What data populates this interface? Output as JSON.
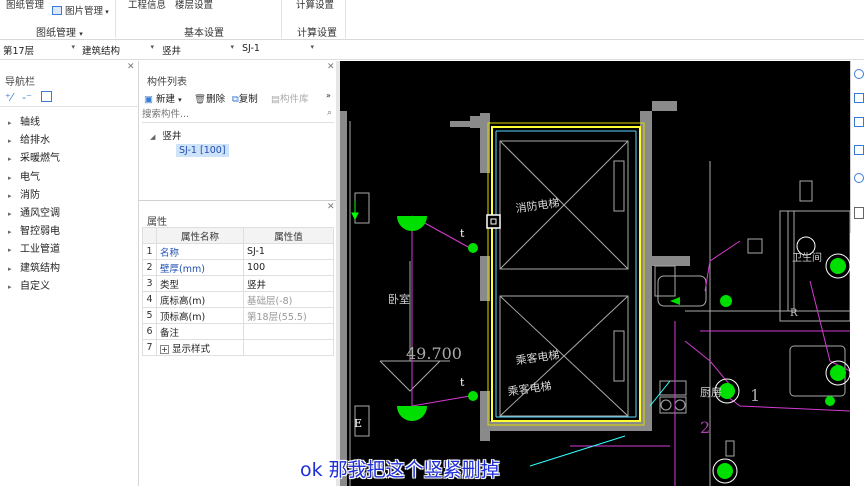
{
  "ribbon": {
    "drawing_mgmt": "图纸管理",
    "image_mgmt": "图片管理",
    "project_info": "工程信息",
    "floor_settings": "楼层设置",
    "calc_settings": "计算设置",
    "group_drawing": "图纸管理",
    "group_basic": "基本设置",
    "group_calc": "计算设置"
  },
  "selectors": {
    "floor": "第17层",
    "category": "建筑结构",
    "type": "竖井",
    "item": "SJ-1"
  },
  "nav": {
    "title": "导航栏",
    "items": [
      "轴线",
      "给排水",
      "采暖燃气",
      "电气",
      "消防",
      "通风空调",
      "智控弱电",
      "工业管道",
      "建筑结构",
      "自定义"
    ]
  },
  "components": {
    "title": "构件列表",
    "new_label": "新建",
    "delete_label": "删除",
    "copy_label": "复制",
    "library_label": "构件库",
    "search_placeholder": "搜索构件...",
    "tree_root": "竖井",
    "tree_child": "SJ-1 [100]"
  },
  "properties": {
    "title": "属性",
    "col_name": "属性名称",
    "col_value": "属性值",
    "rows": [
      {
        "num": "1",
        "name": "名称",
        "value": "SJ-1"
      },
      {
        "num": "2",
        "name": "壁厚(mm)",
        "value": "100"
      },
      {
        "num": "3",
        "name": "类型",
        "value": "竖井"
      },
      {
        "num": "4",
        "name": "底标高(m)",
        "value": "基础层(-8)"
      },
      {
        "num": "5",
        "name": "顶标高(m)",
        "value": "第18层(55.5)"
      },
      {
        "num": "6",
        "name": "备注",
        "value": ""
      },
      {
        "num": "7",
        "name": "显示样式",
        "value": ""
      }
    ]
  },
  "cad": {
    "room_bedroom": "卧室",
    "elevator_fire": "消防电梯",
    "elevator_passenger": "乘客电梯",
    "elevator_passenger2": "乘客电梯",
    "dimension": "49.700",
    "bathroom": "卫生间",
    "kitchen": "厨房",
    "label_e": "E",
    "label_t1": "t",
    "label_t2": "t",
    "label_r": "R",
    "label_1": "1",
    "label_2": "2"
  },
  "subtitle": "ok 那我把这个竖紧删掉",
  "colors": {
    "cad_bg": "#000000",
    "wall": "#8a8a8a",
    "selection_yellow": "#ffff33",
    "fixture_green": "#00e000",
    "pipe_magenta": "#d23cd2",
    "subtitle_blue": "#1f2fd8"
  }
}
